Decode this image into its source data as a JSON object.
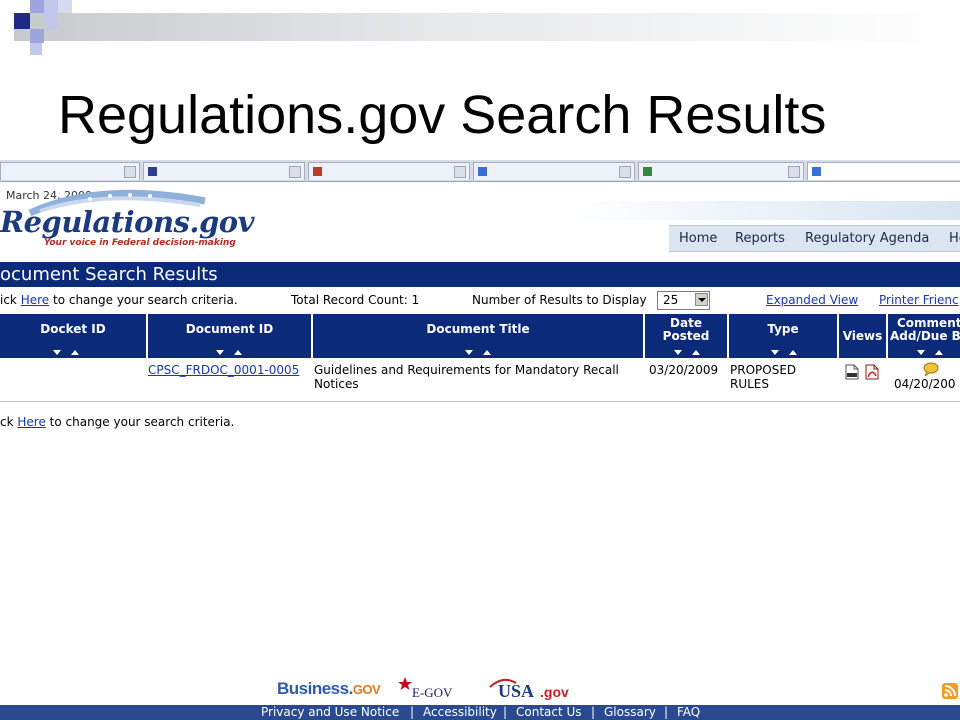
{
  "slide": {
    "title": "Regulations.gov Search Results"
  },
  "page": {
    "date": "March 24, 2009",
    "logo": {
      "word": "Regulations.gov",
      "tagline": "Your voice in Federal decision-making"
    },
    "nav": [
      "Home",
      "Reports",
      "Regulatory Agenda",
      "He"
    ],
    "section_title": "ocument Search Results",
    "criteria": {
      "prefix": "ick ",
      "link": "Here",
      "suffix": " to change your search criteria."
    },
    "total": "Total Record Count: 1",
    "display_label": "Number of Results to Display",
    "display_value": "25",
    "expanded_view": "Expanded View",
    "printer_friendly": "Printer Frienc",
    "columns": {
      "docket": "Docket ID",
      "docid": "Document ID",
      "title": "Document Title",
      "date1": "Date",
      "date2": "Posted",
      "type": "Type",
      "views": "Views",
      "comment1": "Comment",
      "comment2": "Add/Due B"
    },
    "row": {
      "doc_id": "CPSC_FRDOC_0001-0005",
      "title_line1": "Guidelines and Requirements for Mandatory Recall",
      "title_line2": "Notices",
      "date": "03/20/2009",
      "type_line1": "PROPOSED",
      "type_line2": "RULES",
      "due": "04/20/200",
      "view_icons": [
        "html-file-icon",
        "pdf-file-icon"
      ],
      "comment_icon": "comment-bubble-icon"
    },
    "bottom_criteria": {
      "prefix": "ck ",
      "link": "Here",
      "suffix": " to change your search criteria."
    },
    "partners": {
      "business_a": "Business.",
      "business_b": "GOV",
      "egov": "E-GOV",
      "usa_a": "USA",
      "usa_b": ".gov"
    },
    "footer_links": [
      "Privacy and Use Notice",
      "Accessibility",
      "Contact Us",
      "Glossary",
      "FAQ"
    ],
    "footer_sep": "|"
  },
  "colors": {
    "brand_navy": "#0b2a7a",
    "link": "#1a35b0",
    "nav_bg": "#dbe4f1",
    "footer_bar": "#2a4a90",
    "slide_square_dark": "#1f2a85",
    "slide_square_light": "#9ea4dc"
  }
}
